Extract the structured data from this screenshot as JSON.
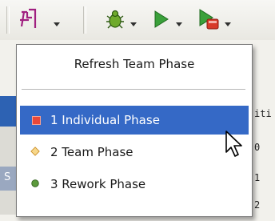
{
  "menu": {
    "header_label": "Refresh Team Phase",
    "items": [
      {
        "label": "1 Individual Phase",
        "icon": "red-square-icon",
        "selected": true,
        "color": "#e8483a"
      },
      {
        "label": "2 Team Phase",
        "icon": "orange-diamond-icon",
        "selected": false,
        "color": "#f0c060"
      },
      {
        "label": "3 Rework Phase",
        "icon": "green-circle-icon",
        "selected": false,
        "color": "#5c9a3c"
      }
    ],
    "selection_color": "#3569c6"
  },
  "background_text": {
    "row1": "iti",
    "row2": "0",
    "row3": "1",
    "row4": "2",
    "left_s": "S"
  }
}
